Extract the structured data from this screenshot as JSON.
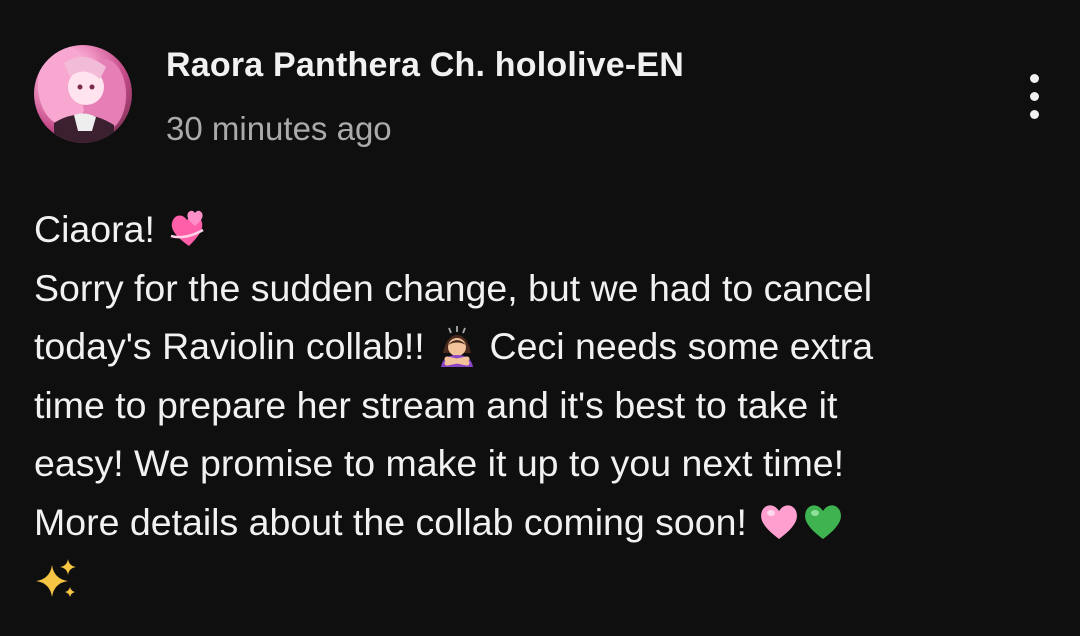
{
  "post": {
    "author": "Raora Panthera Ch. hololive-EN",
    "timestamp": "30 minutes ago",
    "lines": {
      "l1": "Ciaora!",
      "l2": "Sorry for the sudden change, but we had to cancel",
      "l3a": "today's Raviolin collab!!",
      "l3b": "Ceci needs some extra",
      "l4": "time to prepare her stream and it's best to take it",
      "l5": "easy! We promise to make it up to you next time!",
      "l6": "More details about the collab coming soon!"
    },
    "emojis": [
      "two-hearts-icon",
      "woman-bowing-icon",
      "pink-heart-icon",
      "green-heart-icon",
      "sparkles-icon"
    ]
  },
  "colors": {
    "background": "#0f0f0f",
    "text_primary": "#f1f1f1",
    "text_secondary": "#aaaaaa",
    "pink": "#ff8fc8",
    "green": "#3fb34f",
    "gold": "#f6c544"
  }
}
